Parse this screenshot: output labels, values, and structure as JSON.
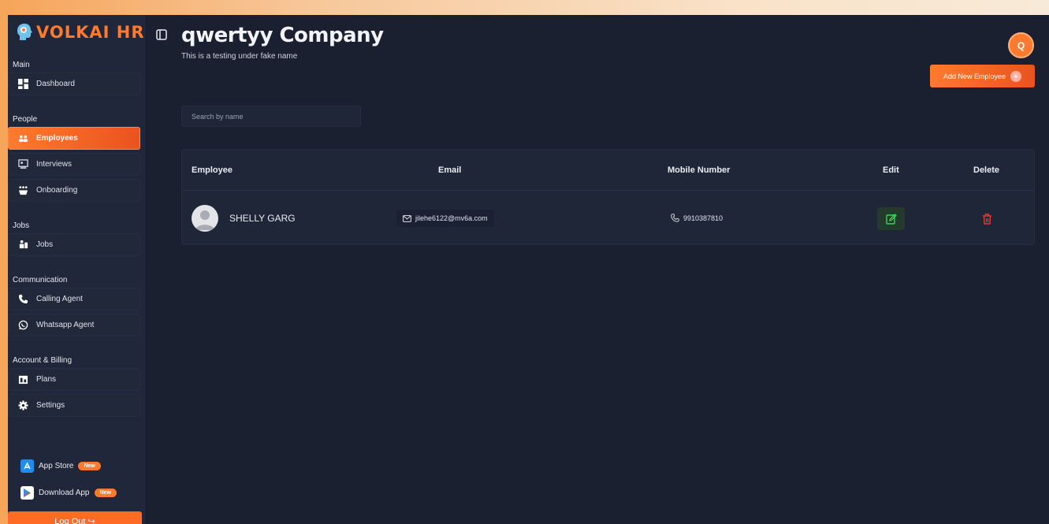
{
  "app": {
    "brand": "VOLKAI HR"
  },
  "sidebar": {
    "sections": [
      {
        "title": "Main",
        "items": [
          {
            "label": "Dashboard",
            "icon": "dashboard-icon"
          }
        ]
      },
      {
        "title": "People",
        "items": [
          {
            "label": "Employees",
            "icon": "employees-icon",
            "active": true
          },
          {
            "label": "Interviews",
            "icon": "interviews-icon"
          },
          {
            "label": "Onboarding",
            "icon": "onboarding-icon"
          }
        ]
      },
      {
        "title": "Jobs",
        "items": [
          {
            "label": "Jobs",
            "icon": "jobs-icon"
          }
        ]
      },
      {
        "title": "Communication",
        "items": [
          {
            "label": "Calling Agent",
            "icon": "phone-call-icon"
          },
          {
            "label": "Whatsapp Agent",
            "icon": "whatsapp-icon"
          }
        ]
      },
      {
        "title": "Account & Billing",
        "items": [
          {
            "label": "Plans",
            "icon": "plans-icon"
          },
          {
            "label": "Settings",
            "icon": "gear-icon"
          }
        ]
      }
    ],
    "app_store": {
      "label": "App Store",
      "badge": "New"
    },
    "download_app": {
      "label": "Download App",
      "badge": "New"
    },
    "logout": "Log Out"
  },
  "header": {
    "title": "qwertyy Company",
    "subtitle": "This is a testing under fake name",
    "avatar_initial": "Q",
    "add_button": "Add New Employee"
  },
  "search": {
    "placeholder": "Search by name"
  },
  "table": {
    "columns": [
      "Employee",
      "Email",
      "Mobile Number",
      "Edit",
      "Delete"
    ],
    "rows": [
      {
        "name": "SHELLY GARG",
        "email": "jilehe6122@mv6a.com",
        "mobile": "9910387810"
      }
    ]
  },
  "colors": {
    "accent": "#ff7a2e",
    "background": "#1b2030",
    "sidebar": "#20273a",
    "edit": "#3fd35a",
    "delete": "#e53935"
  }
}
